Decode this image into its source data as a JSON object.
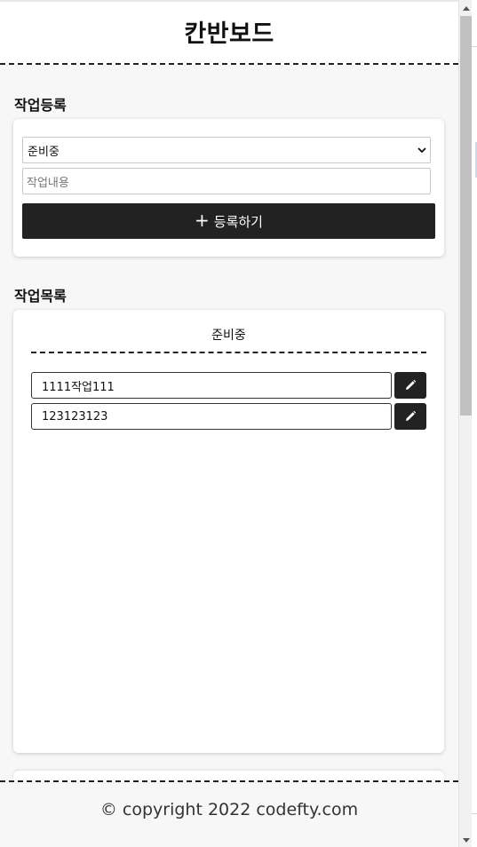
{
  "header": {
    "title": "칸반보드"
  },
  "register": {
    "section_title": "작업등록",
    "status_select": {
      "selected": "준비중"
    },
    "task_input": {
      "placeholder": "작업내용",
      "value": ""
    },
    "submit": {
      "icon": "plus-icon",
      "label": "등록하기"
    }
  },
  "task_list": {
    "section_title": "작업목록",
    "columns": [
      {
        "title": "준비중",
        "tasks": [
          {
            "text": "1111작업111",
            "edit_icon": "pencil-icon"
          },
          {
            "text": "123123123",
            "edit_icon": "pencil-icon"
          }
        ]
      }
    ]
  },
  "footer": {
    "text": "© copyright 2022 codefty.com"
  },
  "colors": {
    "primary": "#222222",
    "background": "#f7f7f7",
    "card": "#ffffff"
  }
}
